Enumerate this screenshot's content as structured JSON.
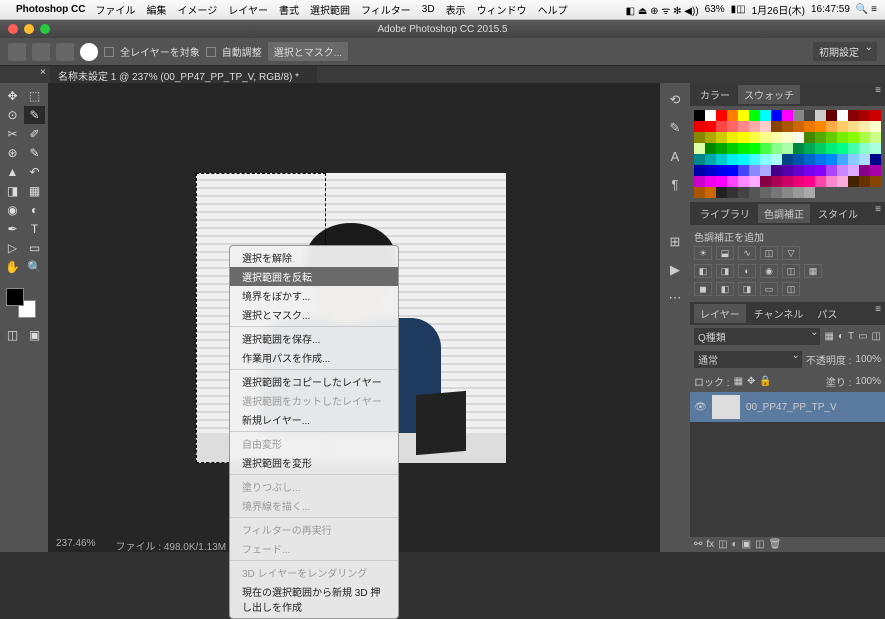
{
  "menubar": {
    "app": "Photoshop CC",
    "items": [
      "ファイル",
      "編集",
      "イメージ",
      "レイヤー",
      "書式",
      "選択範囲",
      "フィルター",
      "3D",
      "表示",
      "ウィンドウ",
      "ヘルプ"
    ],
    "battery": "63%",
    "date": "1月26日(木)",
    "time": "16:47:59"
  },
  "titlebar": {
    "title": "Adobe Photoshop CC 2015.5"
  },
  "optbar": {
    "all_layers": "全レイヤーを対象",
    "auto": "自動調整",
    "mask": "選択とマスク...",
    "preset": "初期設定"
  },
  "tab": {
    "name": "名称未設定 1 @ 237% (00_PP47_PP_TP_V, RGB/8) *"
  },
  "status": {
    "zoom": "237.46%",
    "size": "ファイル : 498.0K/1.13M"
  },
  "ctx": [
    "選択を解除",
    "選択範囲を反転",
    "境界をぼかす...",
    "選択とマスク...",
    "",
    "選択範囲を保存...",
    "作業用パスを作成...",
    "",
    "選択範囲をコピーしたレイヤー",
    "選択範囲をカットしたレイヤー",
    "新規レイヤー...",
    "",
    "自由変形",
    "選択範囲を変形",
    "",
    "塗りつぶし...",
    "境界線を描く...",
    "",
    "フィルターの再実行",
    "フェード...",
    "",
    "3D レイヤーをレンダリング",
    "現在の選択範囲から新規 3D 押し出しを作成"
  ],
  "ctx_disabled": [
    9,
    12,
    15,
    16,
    18,
    19,
    21
  ],
  "ctx_hl": 1,
  "panels": {
    "color": "カラー",
    "swatch": "スウォッチ",
    "lib": "ライブラリ",
    "adj": "色調補正",
    "style": "スタイル",
    "adj_add": "色調補正を追加",
    "layer": "レイヤー",
    "chan": "チャンネル",
    "path": "パス",
    "kind": "Q種類",
    "mode": "通常",
    "opacity": "不透明度 :",
    "opv": "100%",
    "lock": "ロック :",
    "fill": "塗り :",
    "fillv": "100%",
    "layer_name": "00_PP47_PP_TP_V"
  },
  "swatch_colors": [
    "#000",
    "#fff",
    "#f00",
    "#ff8000",
    "#ff0",
    "#0f0",
    "#0ff",
    "#00f",
    "#f0f",
    "#888",
    "#444",
    "#ccc",
    "#600",
    "#fff",
    "#800",
    "#a00",
    "#c00",
    "#e00",
    "#f00",
    "#f44",
    "#f66",
    "#f88",
    "#faa",
    "#fcc",
    "#840",
    "#a50",
    "#c60",
    "#e70",
    "#f80",
    "#fa4",
    "#fc6",
    "#fd8",
    "#fea",
    "#ffc",
    "#880",
    "#aa0",
    "#cc0",
    "#ee0",
    "#ff0",
    "#ff4",
    "#ff8",
    "#ffa",
    "#ffc",
    "#ffe",
    "#480",
    "#5a0",
    "#6c0",
    "#7e0",
    "#8f0",
    "#af4",
    "#cf8",
    "#dfa",
    "#080",
    "#0a0",
    "#0c0",
    "#0e0",
    "#0f0",
    "#4f4",
    "#8f8",
    "#afa",
    "#084",
    "#0a5",
    "#0c6",
    "#0e7",
    "#0f8",
    "#4fa",
    "#8fc",
    "#afd",
    "#088",
    "#0aa",
    "#0cc",
    "#0ee",
    "#0ff",
    "#4ff",
    "#8ff",
    "#aff",
    "#048",
    "#05a",
    "#06c",
    "#07e",
    "#08f",
    "#4af",
    "#8cf",
    "#adf",
    "#008",
    "#00a",
    "#00c",
    "#00e",
    "#00f",
    "#44f",
    "#88f",
    "#aaf",
    "#408",
    "#50a",
    "#60c",
    "#70e",
    "#80f",
    "#a4f",
    "#c8f",
    "#daf",
    "#808",
    "#a0a",
    "#c0c",
    "#e0e",
    "#f0f",
    "#f4f",
    "#f8f",
    "#faf",
    "#804",
    "#a05",
    "#c06",
    "#e07",
    "#f08",
    "#f4a",
    "#f8c",
    "#fad",
    "#420",
    "#630",
    "#840",
    "#a50",
    "#c60",
    "#222",
    "#333",
    "#444",
    "#555",
    "#666",
    "#777",
    "#888",
    "#999",
    "#aaa"
  ]
}
